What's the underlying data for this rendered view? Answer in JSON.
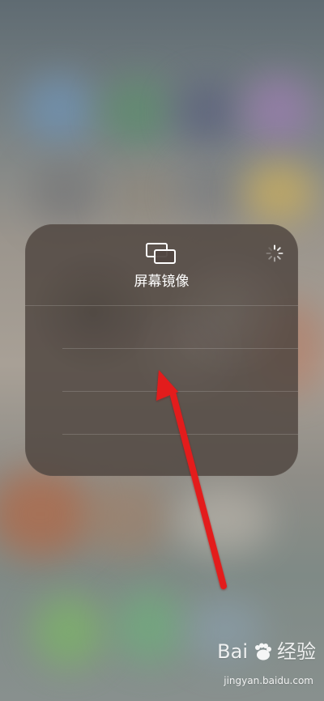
{
  "screen_mirroring": {
    "title": "屏幕镜像",
    "icon": "screen-mirroring-icon",
    "loading_icon": "loading-spinner-icon"
  },
  "watermark": {
    "brand": "Bai",
    "cn": "经验",
    "url": "jingyan.baidu.com",
    "logo_icon": "baidu-paw-icon"
  },
  "colors": {
    "annotation_arrow": "#e31b1b"
  }
}
